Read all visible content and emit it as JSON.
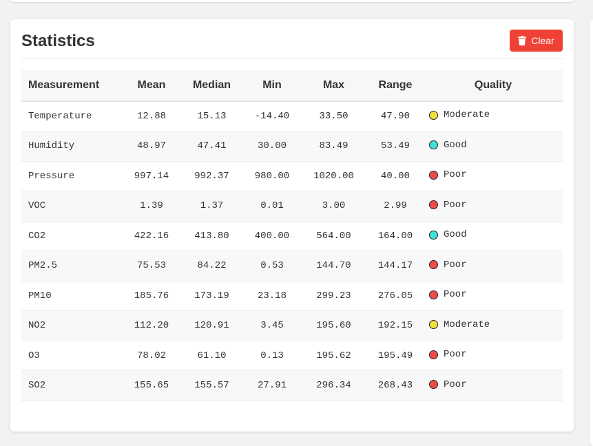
{
  "panel": {
    "title": "Statistics",
    "clear_label": "Clear",
    "clear_icon": "trash-icon",
    "clear_color": "#ef4136"
  },
  "table": {
    "headers": {
      "measurement": "Measurement",
      "mean": "Mean",
      "median": "Median",
      "min": "Min",
      "max": "Max",
      "range": "Range",
      "quality": "Quality"
    },
    "quality_colors": {
      "Good": "#3fe0d6",
      "Moderate": "#f0e03a",
      "Poor": "#ef4b4b"
    },
    "rows": [
      {
        "measurement": "Temperature",
        "mean": "12.88",
        "median": "15.13",
        "min": "-14.40",
        "max": "33.50",
        "range": "47.90",
        "quality": "Moderate"
      },
      {
        "measurement": "Humidity",
        "mean": "48.97",
        "median": "47.41",
        "min": "30.00",
        "max": "83.49",
        "range": "53.49",
        "quality": "Good"
      },
      {
        "measurement": "Pressure",
        "mean": "997.14",
        "median": "992.37",
        "min": "980.00",
        "max": "1020.00",
        "range": "40.00",
        "quality": "Poor"
      },
      {
        "measurement": "VOC",
        "mean": "1.39",
        "median": "1.37",
        "min": "0.01",
        "max": "3.00",
        "range": "2.99",
        "quality": "Poor"
      },
      {
        "measurement": "CO2",
        "mean": "422.16",
        "median": "413.80",
        "min": "400.00",
        "max": "564.00",
        "range": "164.00",
        "quality": "Good"
      },
      {
        "measurement": "PM2.5",
        "mean": "75.53",
        "median": "84.22",
        "min": "0.53",
        "max": "144.70",
        "range": "144.17",
        "quality": "Poor"
      },
      {
        "measurement": "PM10",
        "mean": "185.76",
        "median": "173.19",
        "min": "23.18",
        "max": "299.23",
        "range": "276.05",
        "quality": "Poor"
      },
      {
        "measurement": "NO2",
        "mean": "112.20",
        "median": "120.91",
        "min": "3.45",
        "max": "195.60",
        "range": "192.15",
        "quality": "Moderate"
      },
      {
        "measurement": "O3",
        "mean": "78.02",
        "median": "61.10",
        "min": "0.13",
        "max": "195.62",
        "range": "195.49",
        "quality": "Poor"
      },
      {
        "measurement": "SO2",
        "mean": "155.65",
        "median": "155.57",
        "min": "27.91",
        "max": "296.34",
        "range": "268.43",
        "quality": "Poor"
      }
    ]
  }
}
